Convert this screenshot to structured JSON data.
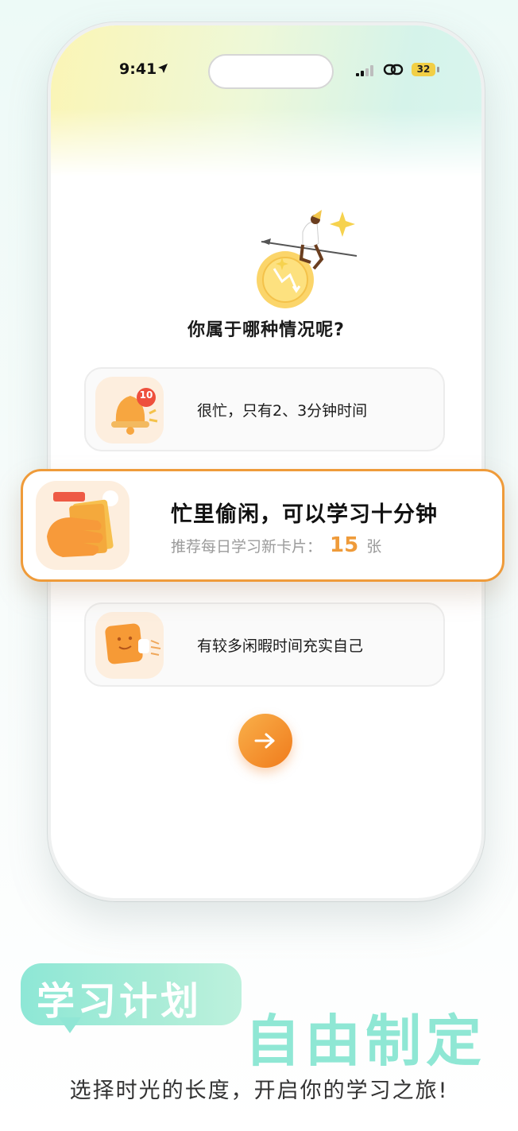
{
  "status_bar": {
    "time": "9:41",
    "battery": "32"
  },
  "question": "你属于哪种情况呢?",
  "options": [
    {
      "label": "很忙，只有2、3分钟时间",
      "badge": "10",
      "icon": "bell-icon"
    },
    {
      "label": "忙里偷闲，可以学习十分钟",
      "icon": "cards-hand-icon",
      "sub_prefix": "推荐每日学习新卡片：",
      "sub_value": "15",
      "sub_suffix": "张",
      "selected": true
    },
    {
      "label": "有较多闲暇时间充实自己",
      "icon": "running-card-icon"
    }
  ],
  "next_icon": "arrow-right-icon",
  "promo": {
    "bubble": "学习计划",
    "slogan": "自由制定",
    "tagline": "选择时光的长度，开启你的学习之旅!"
  },
  "colors": {
    "accent": "#ef9b3a",
    "mint": "#8fe7d4"
  }
}
